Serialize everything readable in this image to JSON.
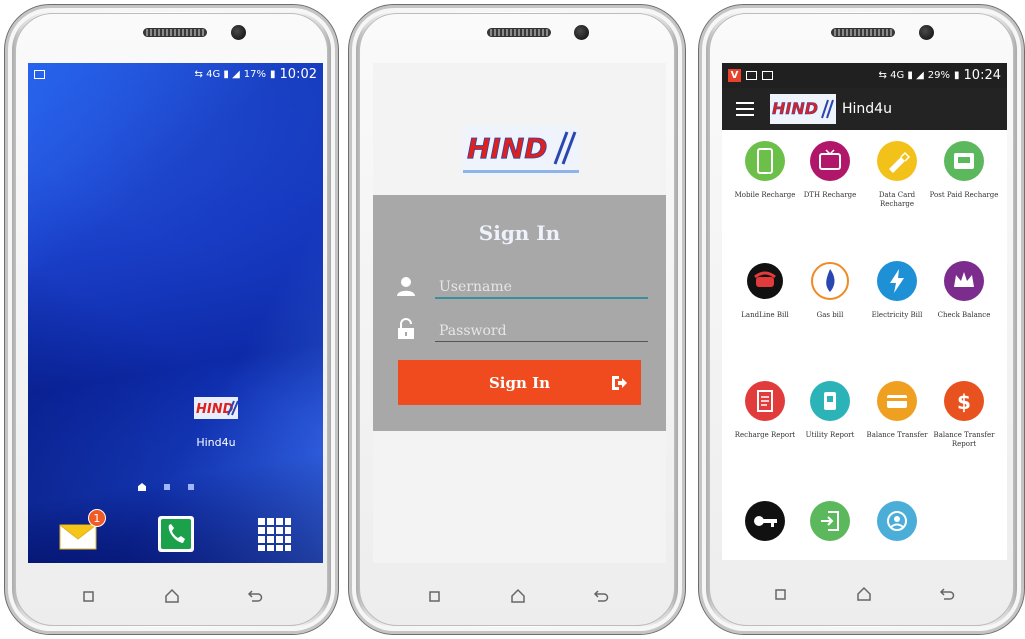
{
  "phone1": {
    "status": {
      "percent": "17%",
      "time": "10:02"
    },
    "app_name": "Hind4u",
    "logo_text": "HIND",
    "notification_count": "1",
    "dock_icons": [
      "email-icon",
      "phone-icon",
      "apps-grid-icon"
    ]
  },
  "phone2": {
    "logo_text": "HIND",
    "title": "Sign In",
    "username_placeholder": "Username",
    "password_placeholder": "Password",
    "signin_label": "Sign In"
  },
  "phone3": {
    "status": {
      "percent": "29%",
      "time": "10:24"
    },
    "title": "Hind4u",
    "logo_text": "HIND",
    "tiles": [
      {
        "label": "Mobile Recharge",
        "color": "#6cc04a",
        "icon": "mobile-icon"
      },
      {
        "label": "DTH Recharge",
        "color": "#b0176a",
        "icon": "tv-icon"
      },
      {
        "label": "Data Card Recharge",
        "color": "#f2c21b",
        "icon": "usb-icon"
      },
      {
        "label": "Post Paid Recharge",
        "color": "#5cb85c",
        "icon": "bill-icon"
      },
      {
        "label": "LandLine Bill",
        "color": "#ffffff",
        "icon": "telephone-icon"
      },
      {
        "label": "Gas bill",
        "color": "#ffffff",
        "icon": "flame-icon"
      },
      {
        "label": "Electricity Bill",
        "color": "#1e90d6",
        "icon": "lightning-icon"
      },
      {
        "label": "Check Balance",
        "color": "#7b2c8c",
        "icon": "crown-icon"
      },
      {
        "label": "Recharge Report",
        "color": "#e23b3b",
        "icon": "report-icon"
      },
      {
        "label": "Utility Report",
        "color": "#2bb3b8",
        "icon": "utility-icon"
      },
      {
        "label": "Balance Transfer",
        "color": "#f0a020",
        "icon": "card-icon"
      },
      {
        "label": "Balance Transfer Report",
        "color": "#e8521f",
        "icon": "dollar-icon"
      },
      {
        "label": "",
        "color": "#111111",
        "icon": "key-icon"
      },
      {
        "label": "",
        "color": "#5cb85c",
        "icon": "login-icon"
      },
      {
        "label": "",
        "color": "#4aaed8",
        "icon": "support-icon"
      }
    ]
  }
}
